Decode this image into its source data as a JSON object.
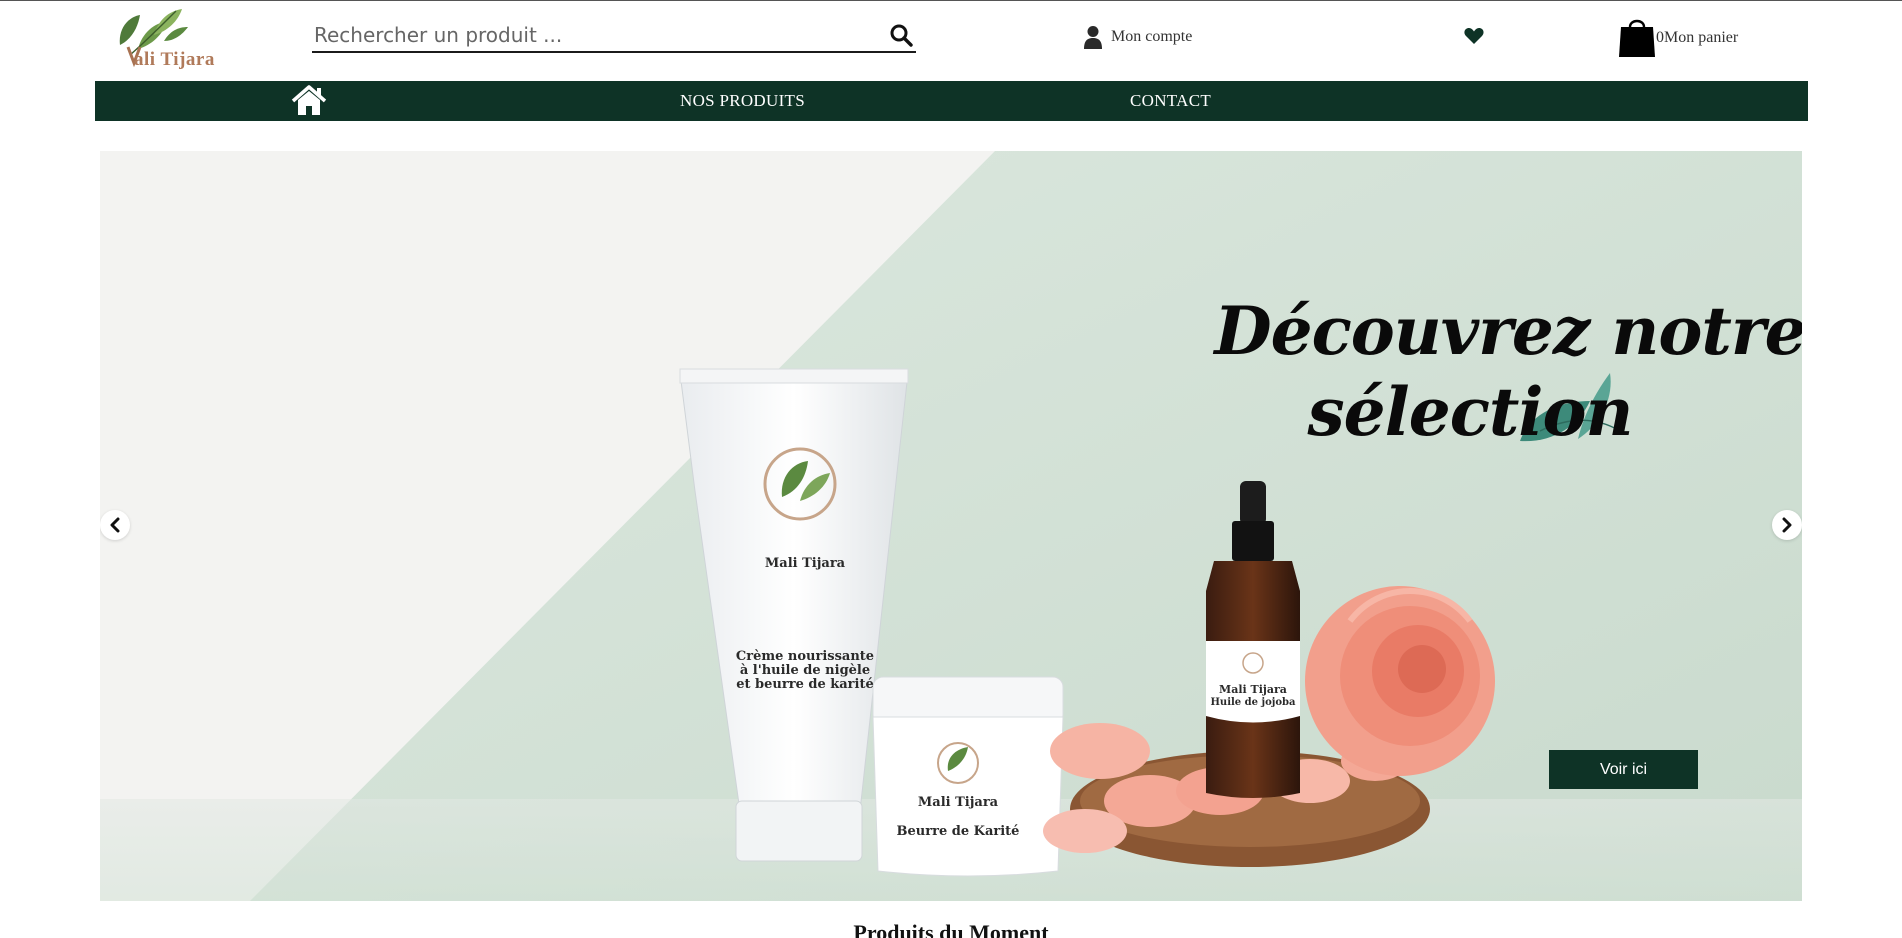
{
  "header": {
    "logo_text": "ali Tijara",
    "search": {
      "placeholder": "Rechercher un produit ..."
    },
    "account_label": "Mon compte",
    "cart": {
      "count": "0",
      "label": "Mon panier"
    }
  },
  "nav": {
    "items": [
      {
        "label": "NOS PRODUITS"
      },
      {
        "label": "CONTACT"
      }
    ]
  },
  "hero": {
    "title_line1": "Découvrez notre",
    "title_line2": "sélection",
    "cta_label": "Voir ici",
    "products": {
      "tube_brand": "Mali Tijara",
      "tube_line1": "Crème nourissante",
      "tube_line2": "à l'huile de nigèle",
      "tube_line3": "et beurre de karité",
      "jar_brand": "Mali Tijara",
      "jar_name": "Beurre de Karité",
      "bottle_brand": "Mali Tijara",
      "bottle_name": "Huile de jojoba"
    }
  },
  "section": {
    "title": "Produits du Moment"
  },
  "colors": {
    "brand_green": "#0e3326",
    "hero_mint": "#d5e3d8",
    "rose": "#f29f8c"
  },
  "icons": {
    "search": "search-icon",
    "account": "user-icon",
    "wishlist": "heart-icon",
    "cart": "shopping-bag-icon",
    "home": "home-icon",
    "prev": "chevron-left-icon",
    "next": "chevron-right-icon"
  }
}
